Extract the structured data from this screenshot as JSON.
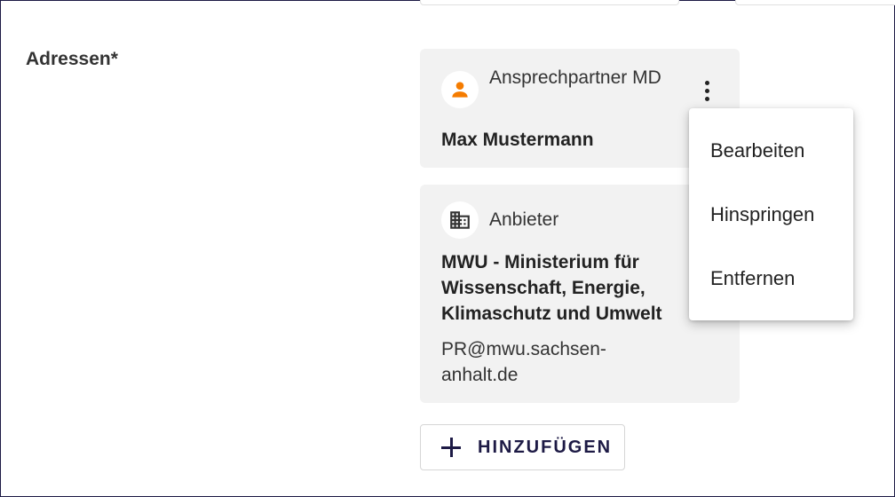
{
  "section": {
    "label": "Adressen*"
  },
  "cards": [
    {
      "icon": "person-icon",
      "type": "Ansprechpartner MD",
      "name": "Max Mustermann"
    },
    {
      "icon": "building-icon",
      "type": "Anbieter",
      "name": "MWU - Ministerium für Wissenschaft, Energie, Klimaschutz und Umwelt",
      "email": "PR@mwu.sachsen-anhalt.de"
    }
  ],
  "add_button": {
    "label": "HINZUFÜGEN"
  },
  "context_menu": {
    "items": [
      "Bearbeiten",
      "Hinspringen",
      "Entfernen"
    ]
  },
  "colors": {
    "accent": "#1d1a45",
    "person_icon": "#f57c00",
    "card_bg": "#f2f2f2"
  }
}
